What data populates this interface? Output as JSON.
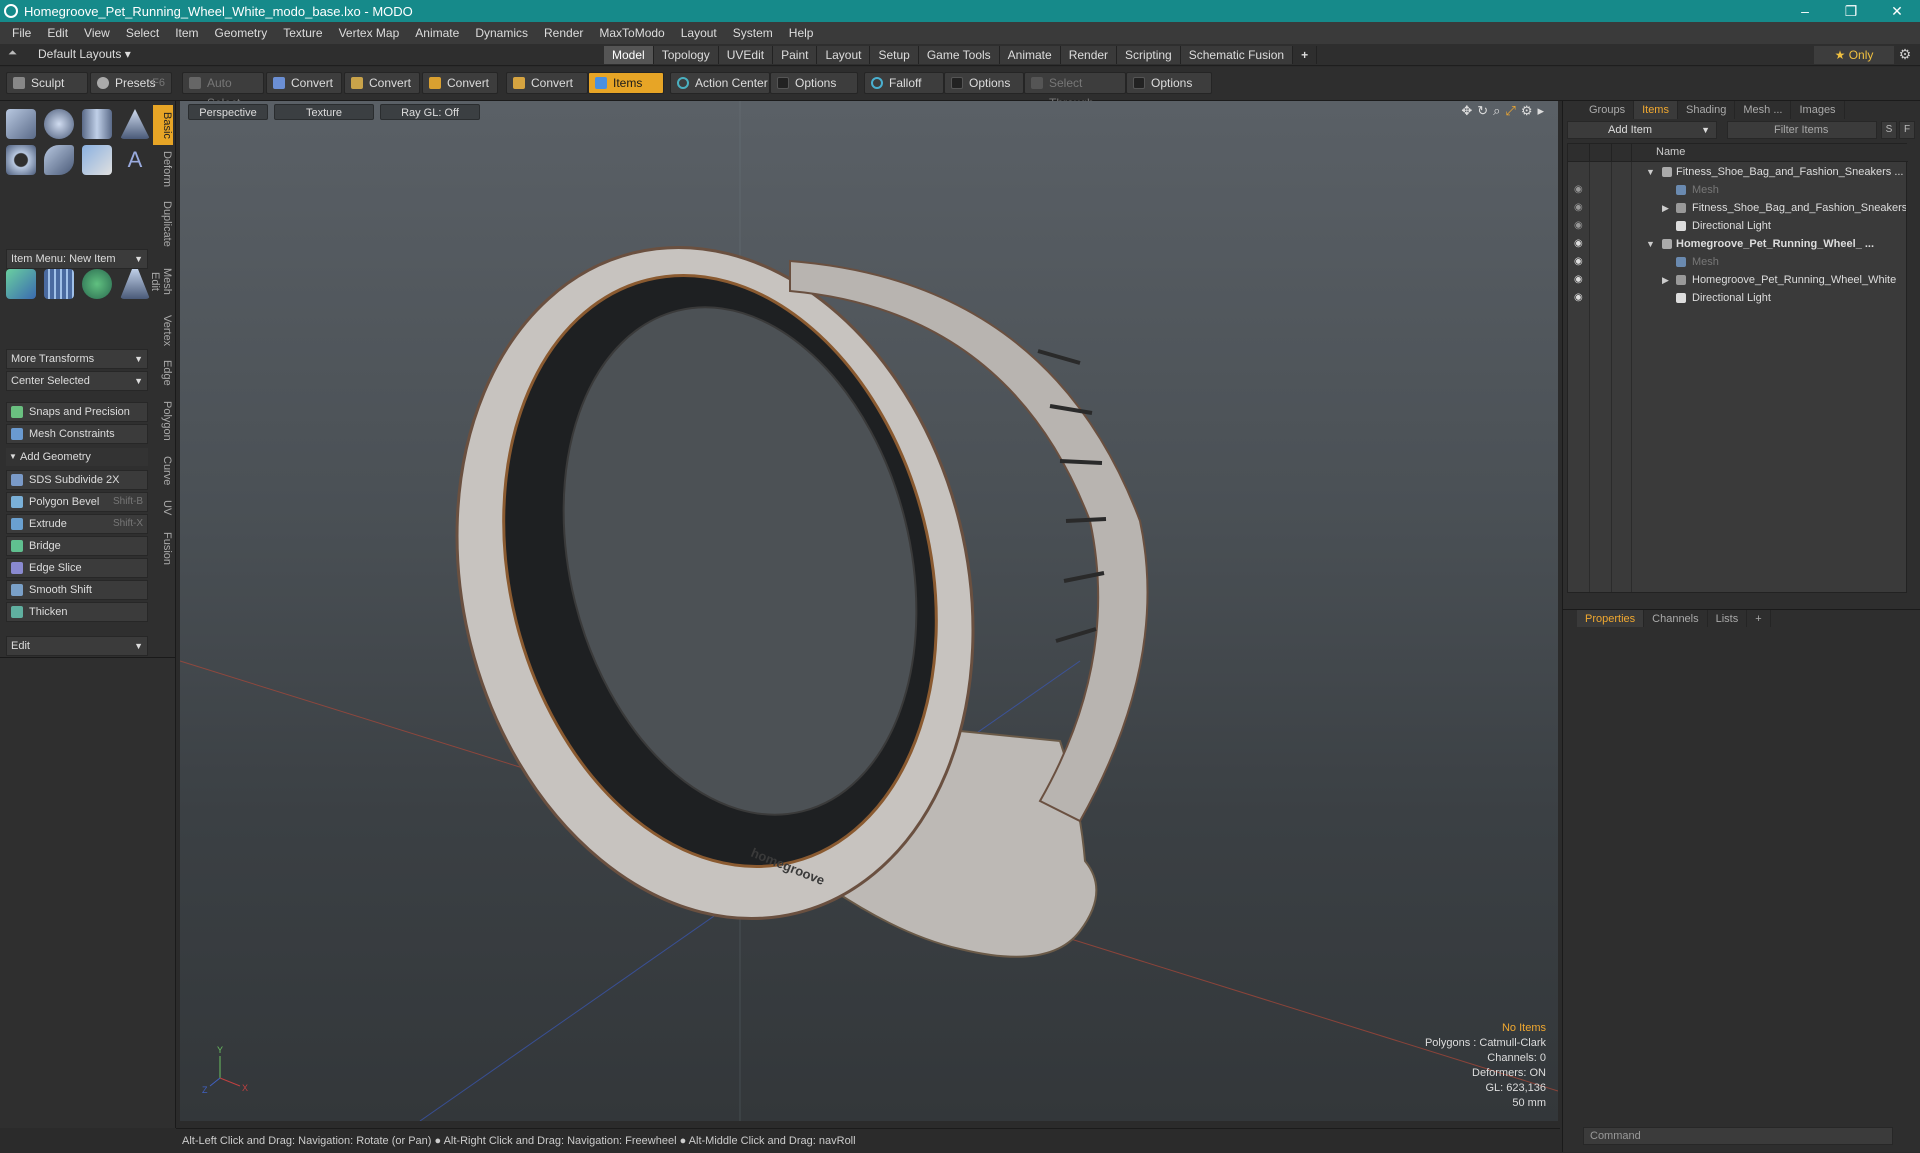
{
  "titlebar": {
    "title": "Homegroove_Pet_Running_Wheel_White_modo_base.lxo - MODO",
    "min": "–",
    "max": "❐",
    "close": "✕"
  },
  "menu": [
    "File",
    "Edit",
    "View",
    "Select",
    "Item",
    "Geometry",
    "Texture",
    "Vertex Map",
    "Animate",
    "Dynamics",
    "Render",
    "MaxToModo",
    "Layout",
    "System",
    "Help"
  ],
  "layoutbar": {
    "default_layouts": "Default Layouts ▾",
    "tabs": [
      "Model",
      "Topology",
      "UVEdit",
      "Paint",
      "Layout",
      "Setup",
      "Game Tools",
      "Animate",
      "Render",
      "Scripting",
      "Schematic Fusion"
    ],
    "active": "Model",
    "only": "★  Only",
    "add": "+"
  },
  "toolbar": {
    "sculpt": "Sculpt",
    "presets": "Presets",
    "presets_key": "F6",
    "auto_select": "Auto Select",
    "convert1": "Convert",
    "convert2": "Convert",
    "convert3": "Convert",
    "convert4": "Convert",
    "items": "Items",
    "action_center": "Action Center",
    "options1": "Options",
    "falloff": "Falloff",
    "options2": "Options",
    "select_through": "Select Through",
    "options3": "Options"
  },
  "left": {
    "item_menu": "Item Menu: New Item",
    "more_transforms": "More Transforms",
    "center_selected": "Center Selected",
    "snaps": "Snaps and Precision",
    "mesh_constraints": "Mesh Constraints",
    "add_geometry": "Add Geometry",
    "tools": [
      {
        "label": "SDS Subdivide 2X",
        "shortcut": ""
      },
      {
        "label": "Polygon Bevel",
        "shortcut": "Shift-B"
      },
      {
        "label": "Extrude",
        "shortcut": "Shift-X"
      },
      {
        "label": "Bridge",
        "shortcut": ""
      },
      {
        "label": "Edge Slice",
        "shortcut": ""
      },
      {
        "label": "Smooth Shift",
        "shortcut": ""
      },
      {
        "label": "Thicken",
        "shortcut": ""
      }
    ],
    "edit": "Edit",
    "vtabs": [
      "Basic",
      "Deform",
      "Duplicate",
      "Mesh Edit",
      "Vertex",
      "Edge",
      "Polygon",
      "Curve",
      "UV",
      "Fusion"
    ]
  },
  "viewport": {
    "perspective": "Perspective",
    "texture": "Texture",
    "raygl": "Ray GL: Off",
    "logo": "homegroove",
    "info": {
      "no_items": "No Items",
      "polygons": "Polygons : Catmull-Clark",
      "channels": "Channels: 0",
      "deformers": "Deformers: ON",
      "gl": "GL: 623,136",
      "size": "50 mm"
    }
  },
  "status": "Alt-Left Click and Drag: Navigation: Rotate (or Pan) ● Alt-Right Click and Drag: Navigation: Freewheel ● Alt-Middle Click and Drag: navRoll",
  "right": {
    "tabs": [
      "Groups",
      "Items",
      "Shading",
      "Mesh ...",
      "Images"
    ],
    "active": "Items",
    "add_item": "Add Item",
    "filter": "Filter Items",
    "s": "S",
    "f": "F",
    "name_col": "Name",
    "rows": [
      "Fitness_Shoe_Bag_and_Fashion_Sneakers ...",
      "Mesh",
      "Fitness_Shoe_Bag_and_Fashion_Sneakers",
      "Directional Light",
      "Homegroove_Pet_Running_Wheel_ ...",
      "Mesh",
      "Homegroove_Pet_Running_Wheel_White",
      "Directional Light"
    ],
    "ptabs": [
      "Properties",
      "Channels",
      "Lists"
    ],
    "ptabs_active": "Properties",
    "plus": "+",
    "command": "Command"
  },
  "colors": {
    "accent": "#e7a526",
    "titlebar": "#168a8a"
  }
}
